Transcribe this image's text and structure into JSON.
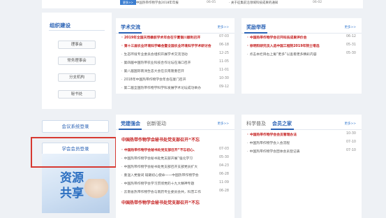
{
  "top": {
    "more": "更多>>",
    "left_item": "· 中国热带作物学会2018年年报",
    "left_date": "06-05",
    "right_item": "· 关于征集前沿领域科技成果的通知",
    "right_date": "06-02"
  },
  "sidebar": {
    "heading": "组织建设",
    "items": [
      "理事会",
      "常务理事会",
      "分支机构",
      "秘书处"
    ]
  },
  "logins": {
    "system": "会议系统登录",
    "member": "学会会员登录"
  },
  "resource": {
    "line1": "资源",
    "line2": "共享"
  },
  "academic": {
    "title": "学术交流",
    "more": "更多>>",
    "rows": [
      {
        "text": "2019年全国天然橡胶学术年会在宁夏银川顺利召开",
        "date": "07-03",
        "red": true
      },
      {
        "text": "第十三届农业环境科学峰会暨全国农业环境科学学术研讨会",
        "date": "06-18",
        "red": true
      },
      {
        "text": "生态环境专业委员会组织开展学术交流活动",
        "date": "12-25",
        "red": false
      },
      {
        "text": "第四届中国热带农业科技合作论坛在海口召开",
        "date": "11-05",
        "red": false
      },
      {
        "text": "第八届国际南洲生态大会在云南隆重召开",
        "date": "11-01",
        "red": false
      },
      {
        "text": "2018年中国热带作物学会年会在厦门召开",
        "date": "10-30",
        "red": false
      },
      {
        "text": "第二届全国热带作物学科学科发展学术论坛成功举办",
        "date": "09-12",
        "red": false
      }
    ]
  },
  "awards": {
    "title": "奖励举荐",
    "more": "更多>>",
    "rows": [
      {
        "text": "中国热带作物学会召开科技成果评价会",
        "date": "06-12",
        "red": true
      },
      {
        "text": "徐明阳研究员入选中国工程院2019年院士增选",
        "date": "05-31",
        "red": true
      },
      {
        "text": "点击本栏目右上角“更多”以查看更多精彩内容",
        "date": "05-30",
        "red": false
      }
    ]
  },
  "party": {
    "tab1": "党建强会",
    "tab2": "创新驱动",
    "more": "更多>>",
    "headline": "中国热带作物学会秘书处党支部召开“不忘",
    "rows": [
      {
        "text": "中国热带作物学会秘书处党支部召开“不忘初心、",
        "date": "07-03",
        "red": true
      },
      {
        "text": "中国热带作物学会秘书处党支部开展“强化学习",
        "date": "05-30",
        "red": false
      },
      {
        "text": "中国热带作物学会秘书处党支部召开支部党员扩大",
        "date": "04-23",
        "red": false
      },
      {
        "text": "重温入党誓词 砥砺初心使命——中国热带作物学会",
        "date": "06-28",
        "red": false
      },
      {
        "text": "中国热带作物学会学习贯彻党的十九大精神专题",
        "date": "11-09",
        "red": false
      },
      {
        "text": "云南省热带作物学会与南药专业委员会共，科普工作",
        "date": "06-28",
        "red": false
      }
    ],
    "bottom": "中国热带作物学会秘书处党支部召开“不忘"
  },
  "science": {
    "tab1": "科学普及",
    "tab2": "会员之家",
    "more": "更多>>",
    "rows": [
      {
        "text": "中国热带作物学会会员管理办法",
        "date": "10-30",
        "red": true
      },
      {
        "text": "中国热带作物学会入会流程",
        "date": "07-10",
        "red": false
      },
      {
        "text": "中国热带作物学会团体会员登记表",
        "date": "07-10",
        "red": false
      }
    ]
  }
}
